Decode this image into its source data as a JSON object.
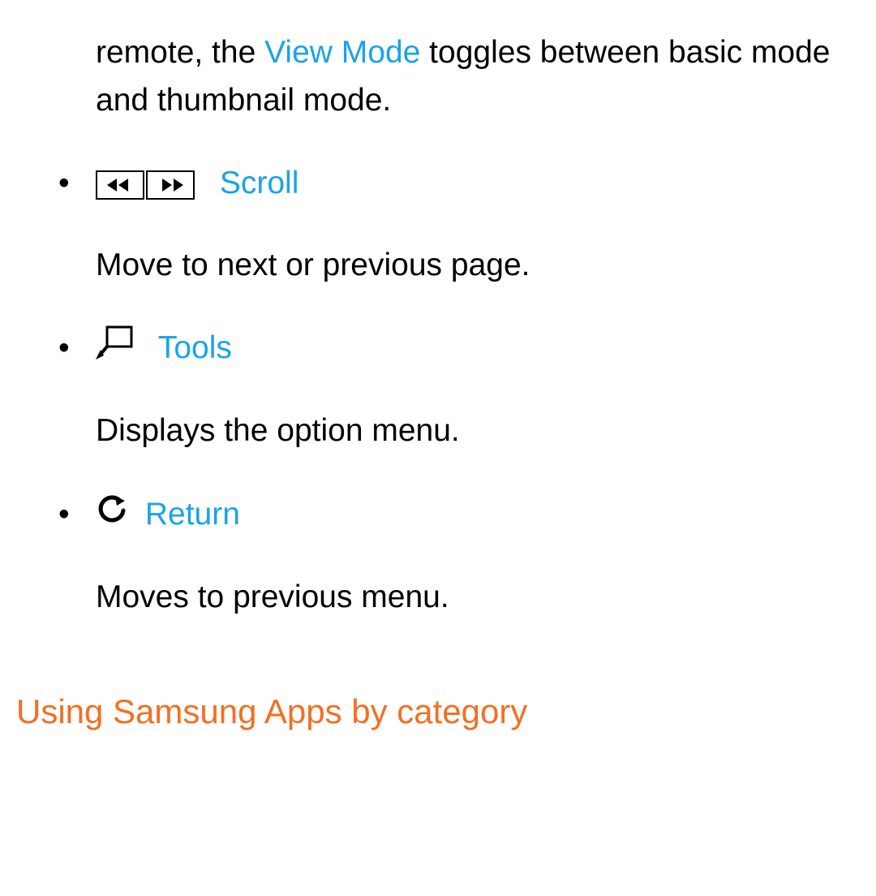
{
  "intro": {
    "part1": "remote, the ",
    "viewmode": "View Mode",
    "part2": " toggles between basic mode and thumbnail mode."
  },
  "items": [
    {
      "label": "Scroll",
      "desc": "Move to next or previous page."
    },
    {
      "label": "Tools",
      "desc": "Displays the option menu."
    },
    {
      "label": "Return",
      "desc": "Moves to previous menu."
    }
  ],
  "heading": "Using Samsung Apps by category"
}
